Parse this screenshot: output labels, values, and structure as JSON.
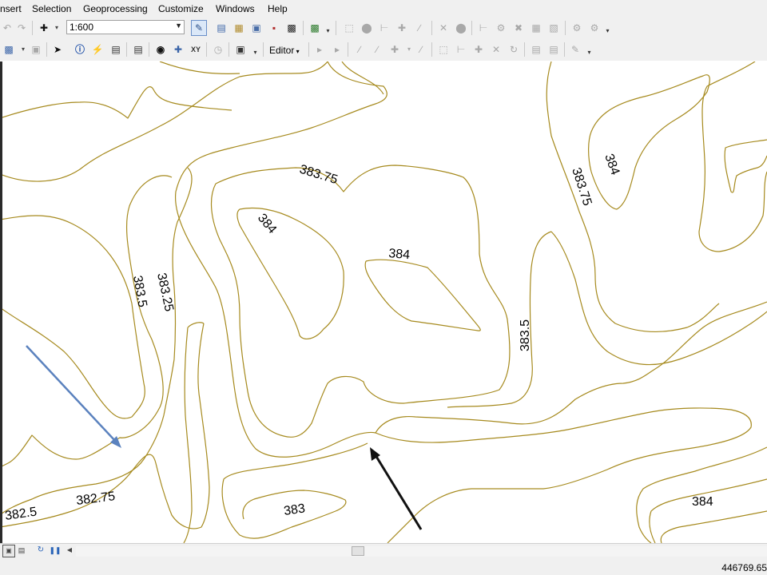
{
  "menu": [
    "nsert",
    "Selection",
    "Geoprocessing",
    "Customize",
    "Windows",
    "Help"
  ],
  "toolbar1": {
    "scale_value": "1:600",
    "icons": [
      "undo-icon",
      "redo-icon",
      "add-data-icon",
      "editor-toolbar-icon",
      "table-of-contents-icon",
      "catalog-icon",
      "search-window-icon",
      "arctoolbox-icon",
      "python-window-icon",
      "model-builder-icon"
    ]
  },
  "toolbar2": {
    "editor_label": "Editor",
    "icons": [
      "select-elements-icon",
      "identify-icon",
      "html-popup-icon",
      "find-icon",
      "go-to-xy-icon",
      "measure-icon",
      "time-slider-icon",
      "create-viewer-window-icon"
    ]
  },
  "map": {
    "contour_labels": [
      {
        "text": "383.75",
        "name": "contour-label-383-75-center"
      },
      {
        "text": "383.75",
        "name": "contour-label-383-75-right"
      },
      {
        "text": "384",
        "name": "contour-label-384-top-right"
      },
      {
        "text": "384",
        "name": "contour-label-384-left"
      },
      {
        "text": "384",
        "name": "contour-label-384-center"
      },
      {
        "text": "383.5",
        "name": "contour-label-383-5-left"
      },
      {
        "text": "383.25",
        "name": "contour-label-383-25"
      },
      {
        "text": "383.5",
        "name": "contour-label-383-5-right"
      },
      {
        "text": "382.75",
        "name": "contour-label-382-75"
      },
      {
        "text": "382.5",
        "name": "contour-label-382-5"
      },
      {
        "text": "383",
        "name": "contour-label-383"
      },
      {
        "text": "384",
        "name": "contour-label-384-bottom-right"
      }
    ],
    "contour_color": "#a68a1e",
    "arrow_blue_color": "#5b82be",
    "arrow_black_color": "#111111"
  },
  "status": {
    "coordinates": "446769.65"
  }
}
